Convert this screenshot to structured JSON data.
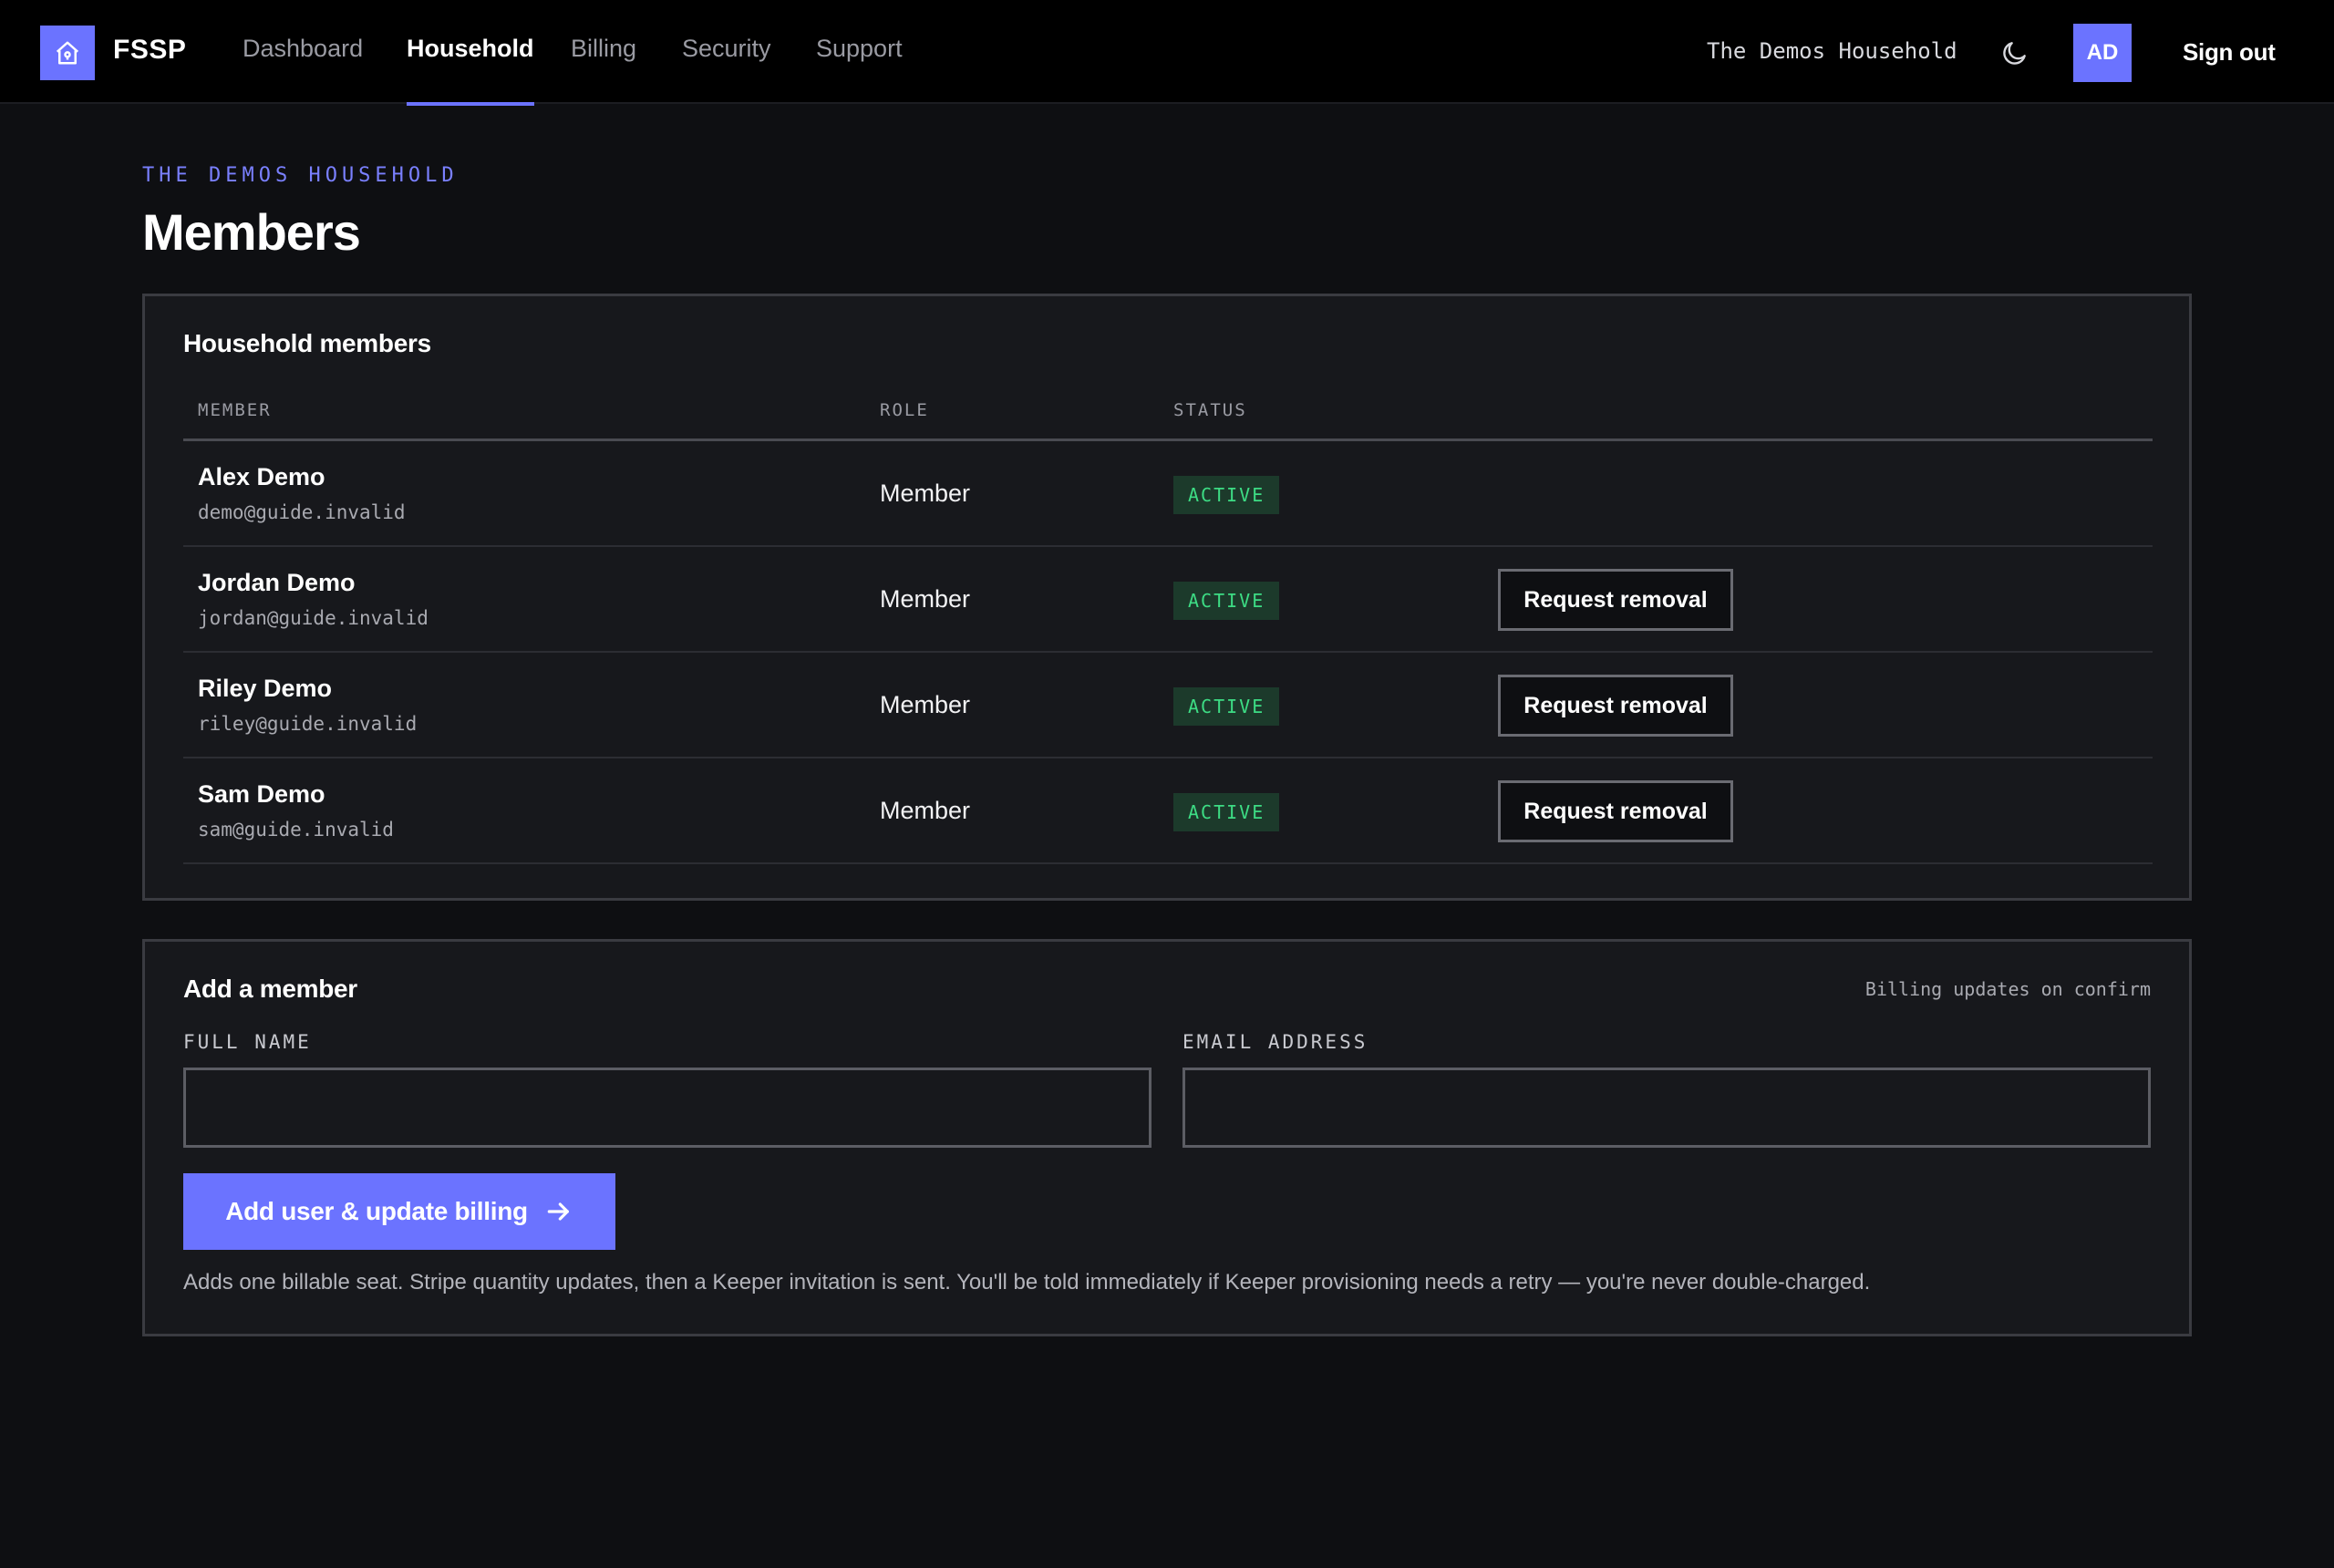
{
  "app": {
    "logo_text": "FSSP",
    "logo_icon": "house-icon"
  },
  "nav": {
    "tabs": [
      {
        "label": "Dashboard",
        "active": false
      },
      {
        "label": "Household",
        "active": true
      },
      {
        "label": "Billing",
        "active": false
      },
      {
        "label": "Security",
        "active": false
      },
      {
        "label": "Support",
        "active": false
      }
    ],
    "household_name": "The Demos Household",
    "theme_icon": "moon-icon",
    "avatar_initials": "AD",
    "sign_out": "Sign out"
  },
  "page": {
    "eyebrow": "THE DEMOS HOUSEHOLD",
    "title": "Members"
  },
  "members_card": {
    "title": "Household members",
    "columns": [
      "MEMBER",
      "ROLE",
      "STATUS"
    ],
    "rows": [
      {
        "name": "Alex Demo",
        "email": "demo@guide.invalid",
        "role": "Member",
        "status": "ACTIVE",
        "action": null
      },
      {
        "name": "Jordan Demo",
        "email": "jordan@guide.invalid",
        "role": "Member",
        "status": "ACTIVE",
        "action": "Request removal"
      },
      {
        "name": "Riley Demo",
        "email": "riley@guide.invalid",
        "role": "Member",
        "status": "ACTIVE",
        "action": "Request removal"
      },
      {
        "name": "Sam Demo",
        "email": "sam@guide.invalid",
        "role": "Member",
        "status": "ACTIVE",
        "action": "Request removal"
      }
    ]
  },
  "add_card": {
    "title": "Add a member",
    "billing_note": "Billing updates on confirm",
    "full_name_label": "FULL NAME",
    "full_name_value": "",
    "email_label": "EMAIL ADDRESS",
    "email_value": "",
    "submit_label": "Add user & update billing",
    "submit_icon": "arrow-right-icon",
    "help_text": "Adds one billable seat. Stripe quantity updates, then a Keeper invitation is sent. You'll be told immediately if Keeper provisioning needs a retry — you're never double-charged."
  },
  "colors": {
    "accent": "#6b73ff",
    "background": "#0e0f12",
    "card": "#17181c",
    "status_active_text": "#3ddc84",
    "status_active_bg": "#1c3a2b"
  }
}
